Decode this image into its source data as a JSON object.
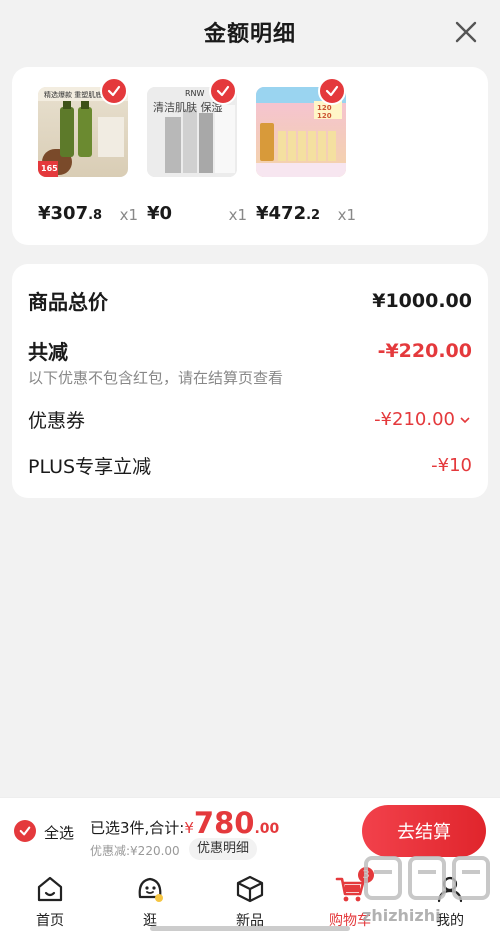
{
  "header": {
    "title": "金额明细"
  },
  "products": [
    {
      "price_int": "¥307",
      "price_dec": ".8",
      "qty": "x1",
      "image_text": "精选爆款 重塑肌底",
      "promo_text": "165"
    },
    {
      "price_int": "¥0",
      "price_dec": "",
      "qty": "x1",
      "image_text": "清洁肌肤 保湿",
      "brand_text": "RNW"
    },
    {
      "price_int": "¥472",
      "price_dec": ".2",
      "qty": "x1",
      "image_text": "120 120"
    }
  ],
  "summary": {
    "total_label": "商品总价",
    "total_value": "¥1000.00",
    "reduce_label": "共减",
    "reduce_value": "-¥220.00",
    "note": "以下优惠不包含红包，请在结算页查看",
    "coupon_label": "优惠券",
    "coupon_value": "-¥210.00",
    "plus_label": "PLUS专享立减",
    "plus_value": "-¥10"
  },
  "bottom_bar": {
    "select_all": "全选",
    "selected_text": "已选3件,合计:",
    "currency": "¥",
    "amount_int": "780",
    "amount_dec": ".00",
    "discount_text": "优惠减:¥220.00",
    "detail_button": "优惠明细",
    "checkout_button": "去结算"
  },
  "tabbar": {
    "tabs": [
      {
        "label": "首页",
        "icon": "home-icon"
      },
      {
        "label": "逛",
        "icon": "discover-icon"
      },
      {
        "label": "新品",
        "icon": "box-icon"
      },
      {
        "label": "购物车",
        "icon": "cart-icon",
        "badge": "3",
        "active": true
      },
      {
        "label": "我的",
        "icon": "user-icon"
      }
    ]
  },
  "watermark": "zhizhizhi",
  "colors": {
    "accent": "#e4393c",
    "background": "#f2f2f2",
    "card": "#ffffff"
  }
}
